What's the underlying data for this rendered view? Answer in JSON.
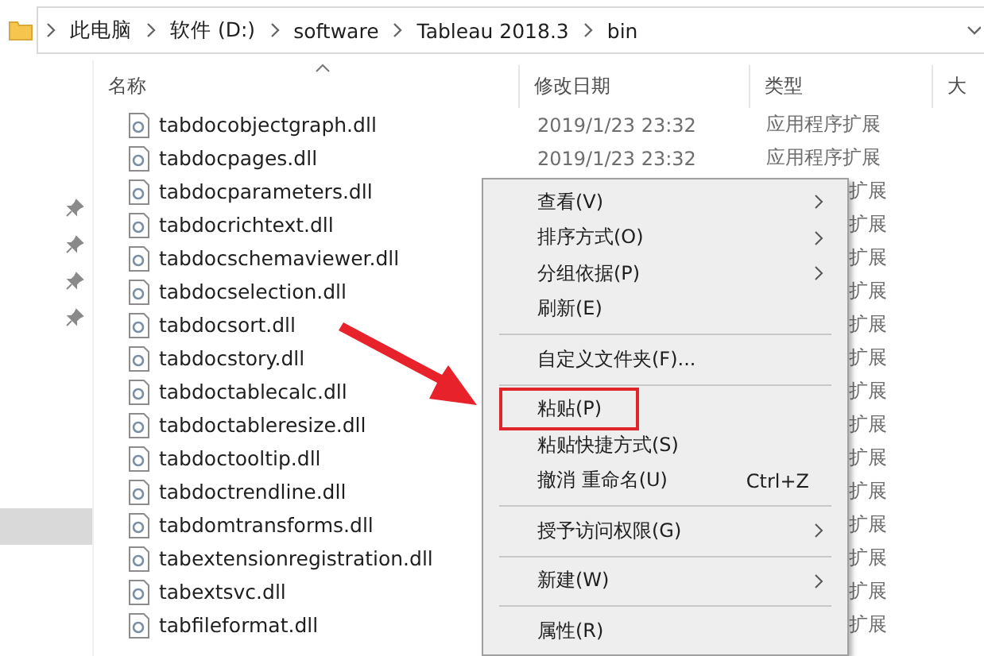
{
  "address_bar": {
    "path": [
      "此电脑",
      "软件 (D:)",
      "software",
      "Tableau 2018.3",
      "bin"
    ]
  },
  "file_list": {
    "columns": [
      "名称",
      "修改日期",
      "类型",
      "大"
    ],
    "rows": [
      {
        "name": "tabdocobjectgraph.dll",
        "date": "2019/1/23 23:32",
        "type": "应用程序扩展"
      },
      {
        "name": "tabdocpages.dll",
        "date": "2019/1/23 23:32",
        "type": "应用程序扩展"
      },
      {
        "name": "tabdocparameters.dll",
        "type": "扩展"
      },
      {
        "name": "tabdocrichtext.dll",
        "type": "扩展"
      },
      {
        "name": "tabdocschemaviewer.dll",
        "type": "扩展"
      },
      {
        "name": "tabdocselection.dll",
        "type": "扩展"
      },
      {
        "name": "tabdocsort.dll",
        "type": "扩展"
      },
      {
        "name": "tabdocstory.dll",
        "type": "扩展"
      },
      {
        "name": "tabdoctablecalc.dll",
        "type": "扩展"
      },
      {
        "name": "tabdoctableresize.dll",
        "type": "扩展"
      },
      {
        "name": "tabdoctooltip.dll",
        "type": "扩展"
      },
      {
        "name": "tabdoctrendline.dll",
        "type": "扩展"
      },
      {
        "name": "tabdomtransforms.dll",
        "type": "扩展"
      },
      {
        "name": "tabextensionregistration.dll",
        "type": "扩展"
      },
      {
        "name": "tabextsvc.dll",
        "type": "扩展"
      },
      {
        "name": "tabfileformat.dll",
        "type": "扩展"
      }
    ]
  },
  "context_menu": {
    "items": [
      {
        "kind": "item",
        "label": "查看(V)",
        "submenu": true
      },
      {
        "kind": "item",
        "label": "排序方式(O)",
        "submenu": true
      },
      {
        "kind": "item",
        "label": "分组依据(P)",
        "submenu": true
      },
      {
        "kind": "item",
        "label": "刷新(E)"
      },
      {
        "kind": "separator"
      },
      {
        "kind": "item",
        "label": "自定义文件夹(F)..."
      },
      {
        "kind": "separator"
      },
      {
        "kind": "item",
        "label": "粘贴(P)",
        "highlighted": true
      },
      {
        "kind": "item",
        "label": "粘贴快捷方式(S)"
      },
      {
        "kind": "item",
        "label": "撤消 重命名(U)",
        "shortcut": "Ctrl+Z"
      },
      {
        "kind": "separator"
      },
      {
        "kind": "item",
        "label": "授予访问权限(G)",
        "submenu": true
      },
      {
        "kind": "separator"
      },
      {
        "kind": "item",
        "label": "新建(W)",
        "submenu": true
      },
      {
        "kind": "separator"
      },
      {
        "kind": "item",
        "label": "属性(R)"
      }
    ]
  }
}
